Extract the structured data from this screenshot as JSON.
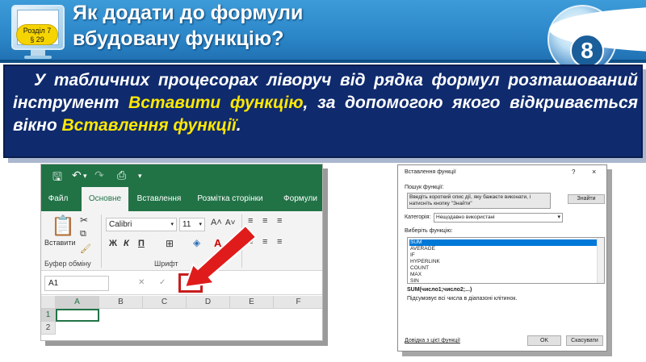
{
  "header": {
    "title_line1": "Як додати до формули",
    "title_line2": "вбудовану функцію?",
    "section_line1": "Розділ 7",
    "section_line2": "§ 29",
    "grade": "8",
    "accent_color": "#2b86c8"
  },
  "body": {
    "text_part1": "У табличних процесорах ліворуч від рядка формул розташований інструмент ",
    "highlight1": "Вставити функцію",
    "text_part2": ", за допомогою якого відкривається вікно ",
    "highlight2": "Вставлення функції",
    "text_part3": ".",
    "highlight_color": "#ffe800"
  },
  "excel": {
    "tabs": [
      "Файл",
      "Основне",
      "Вставлення",
      "Розмітка сторінки",
      "Формули"
    ],
    "active_tab": "Основне",
    "paste_label": "Вставити",
    "font_name": "Calibri",
    "font_size": "11",
    "clipboard_group": "Буфер обміну",
    "font_group": "Шрифт",
    "bold": "Ж",
    "italic": "К",
    "underline": "П",
    "name_box": "A1",
    "fx_label": "fx",
    "columns": [
      "A",
      "B",
      "C",
      "D",
      "E",
      "F"
    ],
    "rows": [
      "1",
      "2"
    ]
  },
  "dialog": {
    "title": "Вставлення функції",
    "help": "?",
    "close": "×",
    "search_label": "Пошук функції:",
    "search_placeholder_line1": "Введіть короткий опис дії, яку бажаєте виконати, і",
    "search_placeholder_line2": "натисніть кнопку \"Знайти\"",
    "find_button": "Знайти",
    "category_label": "Категорія:",
    "category_value": "Нещодавно використані",
    "select_label": "Виберіть функцію:",
    "functions": [
      "SUM",
      "AVERAGE",
      "IF",
      "HYPERLINK",
      "COUNT",
      "MAX",
      "SIN"
    ],
    "selected_function": "SUM",
    "syntax": "SUM(число1;число2;...)",
    "description": "Підсумовує всі числа в діапазоні клітинок.",
    "help_link": "Довідка з цієї функції",
    "ok_button": "OK",
    "cancel_button": "Скасувати"
  }
}
